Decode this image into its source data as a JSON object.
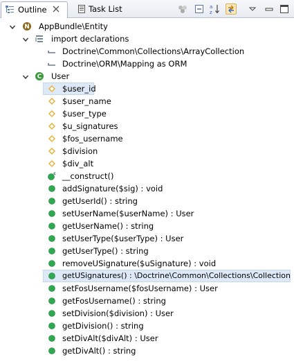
{
  "tabs": {
    "outline_label": "Outline",
    "tasklist_label": "Task List"
  },
  "tree": {
    "root_label": "AppBundle\\Entity",
    "imports_label": "import declarations",
    "imports": [
      "Doctrine\\Common\\Collections\\ArrayCollection",
      "Doctrine\\ORM\\Mapping as ORM"
    ],
    "class_label": "User",
    "fields": [
      "$user_id",
      "$user_name",
      "$user_type",
      "$u_signatures",
      "$fos_username",
      "$division",
      "$div_alt"
    ],
    "constructor_label": "__construct()",
    "methods": [
      "addSignature($sig) : void",
      "getUserId() : string",
      "setUserName($userName) : User",
      "getUserName() : string",
      "setUserType($userType) : User",
      "getUserType() : string",
      "removeUSignature($uSignature) : void",
      "getUSignatures() : \\Doctrine\\Common\\Collections\\Collection",
      "setFosUsername($fosUsername) : User",
      "getFosUsername() : string",
      "setDivision($division) : User",
      "getDivision() : string",
      "setDivAlt($divAlt) : User",
      "getDivAlt() : string"
    ]
  },
  "colors": {
    "namespace_icon": "#8a6a1e",
    "class_icon": "#3e9a3e",
    "field_icon": "#e6b43c",
    "method_icon": "#2fa84f",
    "selection": "#dde9f7"
  }
}
